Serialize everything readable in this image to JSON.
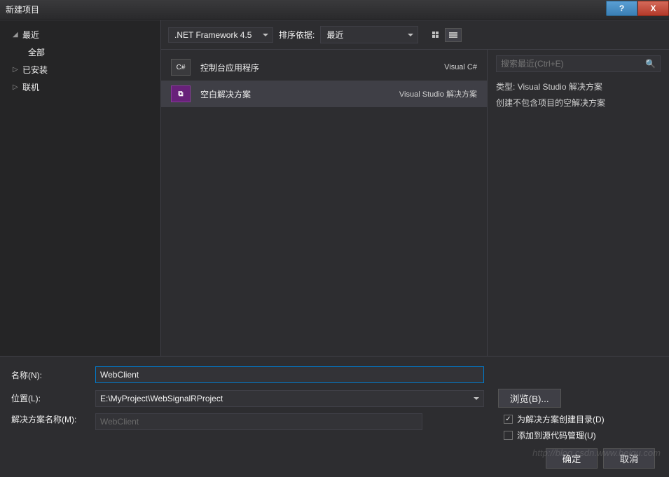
{
  "titlebar": {
    "title": "新建项目",
    "help": "?",
    "close": "X"
  },
  "sidebar": {
    "recent": "最近",
    "all": "全部",
    "installed": "已安装",
    "online": "联机"
  },
  "toolbar": {
    "framework": ".NET Framework 4.5",
    "sort_label": "排序依据:",
    "sort_value": "最近"
  },
  "templates": [
    {
      "icon": "C#",
      "name": "控制台应用程序",
      "lang": "Visual C#"
    },
    {
      "icon": "VS",
      "name": "空白解决方案",
      "lang": "Visual Studio 解决方案"
    }
  ],
  "right": {
    "search_placeholder": "搜索最近(Ctrl+E)",
    "type_label": "类型:",
    "type_value": "Visual Studio 解决方案",
    "desc": "创建不包含项目的空解决方案"
  },
  "form": {
    "name_label": "名称(N):",
    "name_value": "WebClient",
    "location_label": "位置(L):",
    "location_value": "E:\\MyProject\\WebSignalRProject",
    "solution_label": "解决方案名称(M):",
    "solution_value": "WebClient",
    "browse": "浏览(B)...",
    "create_dir": "为解决方案创建目录(D)",
    "add_scm": "添加到源代码管理(U)",
    "ok": "确定",
    "cancel": "取消"
  },
  "watermark": "http://blog.csdn.www.heiqu.com"
}
